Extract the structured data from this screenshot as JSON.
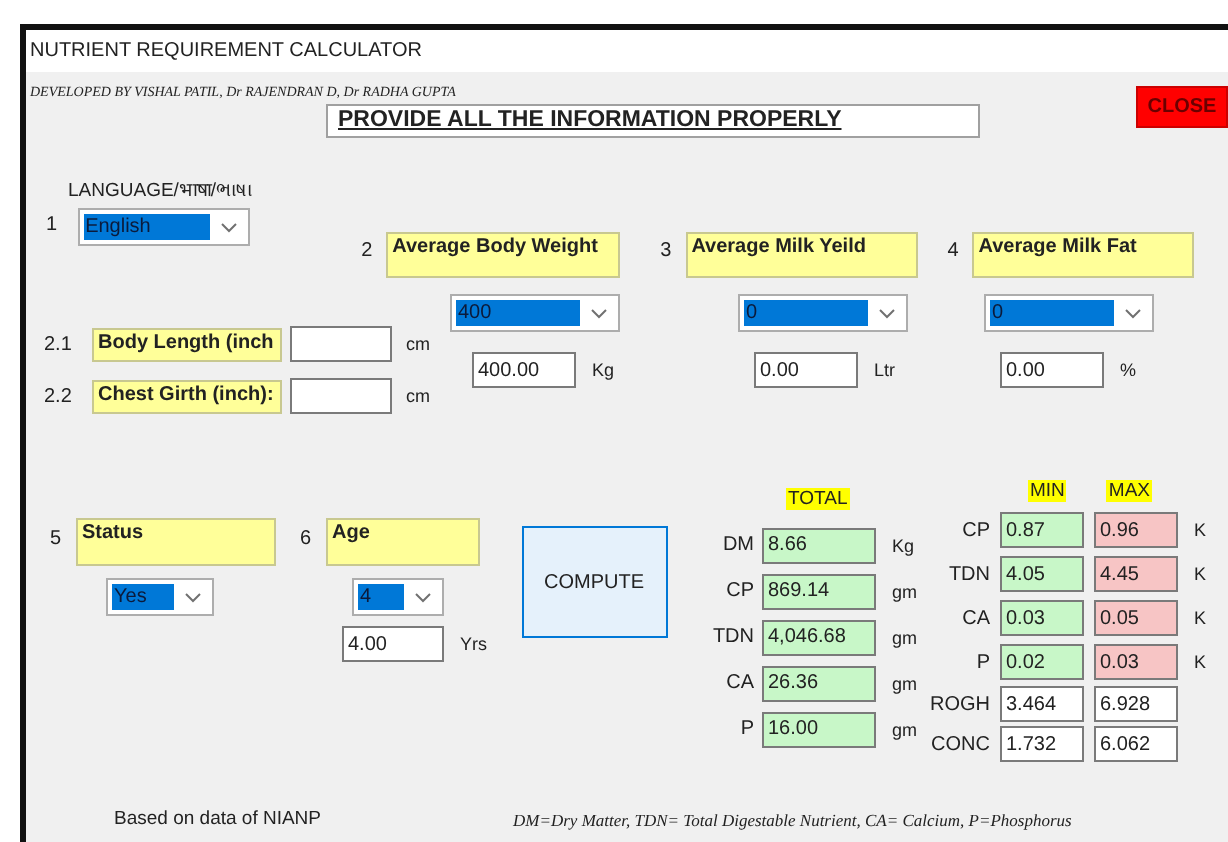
{
  "window": {
    "title": "NUTRIENT REQUIREMENT CALCULATOR"
  },
  "credits": "DEVELOPED BY  VISHAL PATIL, Dr RAJENDRAN D, Dr RADHA GUPTA",
  "close_button": "CLOSE",
  "banner": "PROVIDE ALL THE INFORMATION PROPERLY",
  "language": {
    "label": "LANGUAGE/भाषा/ભાષા",
    "number": "1",
    "choice": "English"
  },
  "inputs": [
    {
      "number": "2",
      "label": "Average Body Weight",
      "choice": "400",
      "value": "400.00",
      "unit": "Kg"
    },
    {
      "number": "3",
      "label": "Average Milk Yeild",
      "choice": "0",
      "value": "0.00",
      "unit": "Ltr"
    },
    {
      "number": "4",
      "label": "Average Milk Fat",
      "choice": "0",
      "value": "0.00",
      "unit": "%"
    }
  ],
  "measurements": [
    {
      "number": "2.1",
      "label": "Body Length (inch",
      "unit": "cm"
    },
    {
      "number": "2.2",
      "label": "Chest Girth (inch):",
      "unit": "cm"
    }
  ],
  "status": {
    "number": "5",
    "label": "Status",
    "choice": "Yes"
  },
  "age": {
    "number": "6",
    "label": "Age",
    "choice": "4",
    "value": "4.00",
    "unit": "Yrs"
  },
  "compute_button": "COMPUTE",
  "totals": {
    "heading": "TOTAL",
    "rows": [
      {
        "name": "DM",
        "value": "8.66",
        "unit": "Kg"
      },
      {
        "name": "CP",
        "value": "869.14",
        "unit": "gm"
      },
      {
        "name": "TDN",
        "value": "4,046.68",
        "unit": "gm"
      },
      {
        "name": "CA",
        "value": "26.36",
        "unit": "gm"
      },
      {
        "name": "P",
        "value": "16.00",
        "unit": "gm"
      }
    ]
  },
  "ranges": {
    "min_heading": "MIN",
    "max_heading": "MAX",
    "rows": [
      {
        "name": "CP",
        "min": "0.87",
        "max": "0.96",
        "unit": "K",
        "kind": "colored"
      },
      {
        "name": "TDN",
        "min": "4.05",
        "max": "4.45",
        "unit": "K",
        "kind": "colored"
      },
      {
        "name": "CA",
        "min": "0.03",
        "max": "0.05",
        "unit": "K",
        "kind": "colored"
      },
      {
        "name": "P",
        "min": "0.02",
        "max": "0.03",
        "unit": "K",
        "kind": "colored"
      },
      {
        "name": "ROGH",
        "min": "3.464",
        "max": "6.928",
        "kind": "plain"
      },
      {
        "name": "CONC",
        "min": "1.732",
        "max": "6.062",
        "kind": "plain"
      }
    ]
  },
  "footer": {
    "source": "Based on data of NIANP",
    "legend": "DM=Dry Matter, TDN= Total Digestable Nutrient, CA= Calcium, P=Phosphorus"
  }
}
